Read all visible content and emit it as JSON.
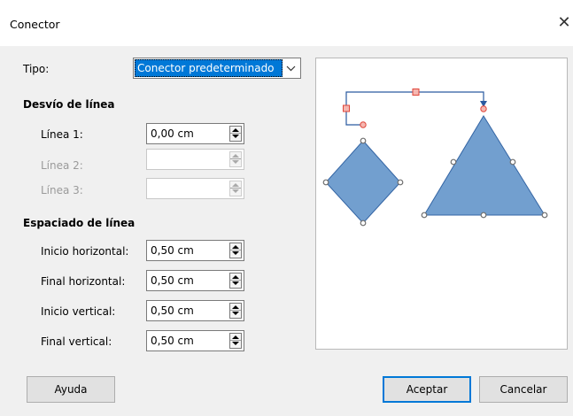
{
  "window": {
    "title": "Conector",
    "close_glyph": "✕"
  },
  "type": {
    "label": "Tipo:",
    "value": "Conector predeterminado"
  },
  "line_skew": {
    "heading": "Desvío de línea",
    "rows": [
      {
        "label": "Línea 1:",
        "value": "0,00 cm",
        "enabled": true
      },
      {
        "label": "Línea 2:",
        "value": "",
        "enabled": false
      },
      {
        "label": "Línea 3:",
        "value": "",
        "enabled": false
      }
    ]
  },
  "line_spacing": {
    "heading": "Espaciado de línea",
    "rows": [
      {
        "label": "Inicio horizontal:",
        "value": "0,50 cm"
      },
      {
        "label": "Final horizontal:",
        "value": "0,50 cm"
      },
      {
        "label": "Inicio vertical:",
        "value": "0,50 cm"
      },
      {
        "label": "Final vertical:",
        "value": "0,50 cm"
      }
    ]
  },
  "buttons": {
    "help": "Ayuda",
    "ok": "Aceptar",
    "cancel": "Cancelar"
  },
  "colors": {
    "shape_fill": "#729fcf",
    "shape_stroke": "#3465a4",
    "connector": "#2a5aa0",
    "handle_red": "#e0463a",
    "glue_gray": "#6e6e6e",
    "accent": "#0078d7"
  }
}
